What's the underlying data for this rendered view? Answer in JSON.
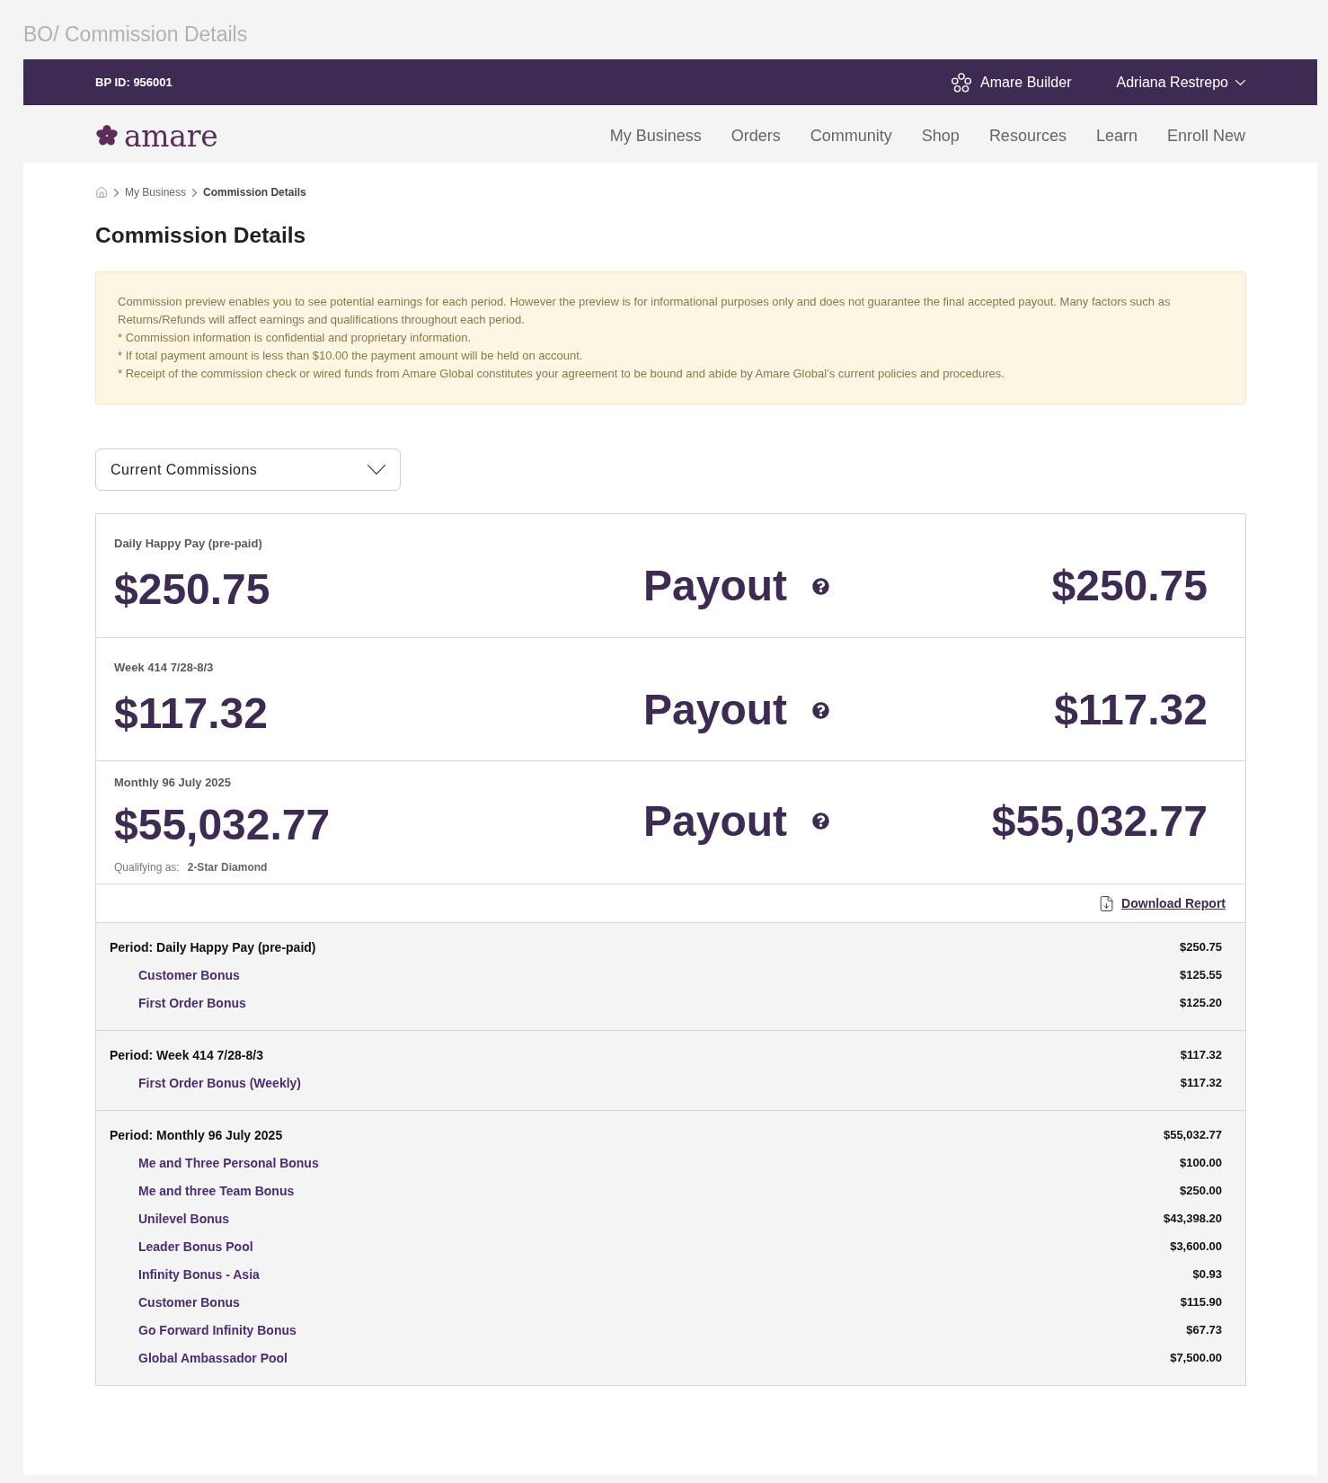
{
  "page_title": "BO/ Commission Details",
  "top_bar": {
    "bp_id": "BP ID: 956001",
    "builder_link": "Amare Builder",
    "user_menu": "Adriana Restrepo"
  },
  "nav": {
    "logo": "amare",
    "items": [
      "My Business",
      "Orders",
      "Community",
      "Shop",
      "Resources",
      "Learn",
      "Enroll New"
    ]
  },
  "breadcrumb": [
    {
      "label": "My Business",
      "current": false
    },
    {
      "label": "Commission Details",
      "current": true
    }
  ],
  "heading": "Commission Details",
  "notice": {
    "paragraph": "Commission preview enables you to see potential earnings for each period. However the preview is for informational purposes only and does not guarantee the final accepted payout. Many factors such as Returns/Refunds will affect earnings and qualifications throughout each period.",
    "bullets": [
      "* Commission information is confidential and proprietary information.",
      "* If total payment amount is less than $10.00 the payment amount will be held on account.",
      "* Receipt of the commission check or wired funds from Amare Global constitutes your agreement to be bound and abide by Amare Global’s current policies and procedures."
    ]
  },
  "period_select": {
    "value": "Current Commissions"
  },
  "summaries": [
    {
      "label": "Daily Happy Pay (pre-paid)",
      "amount": "$250.75",
      "payout_label": "Payout",
      "payout": "$250.75"
    },
    {
      "label": "Week 414 7/28-8/3",
      "amount": "$117.32",
      "payout_label": "Payout",
      "payout": "$117.32"
    },
    {
      "label": "Monthly 96 July 2025",
      "amount": "$55,032.77",
      "payout_label": "Payout",
      "payout": "$55,032.77",
      "qualifying": {
        "label": "Qualifying as:",
        "value": "2-Star Diamond"
      }
    }
  ],
  "download_link": "Download Report",
  "periods": [
    {
      "title": "Period: Daily Happy Pay (pre-paid)",
      "total": "$250.75",
      "items": [
        {
          "name": "Customer Bonus",
          "amount": "$125.55"
        },
        {
          "name": "First Order Bonus",
          "amount": "$125.20"
        }
      ]
    },
    {
      "title": "Period: Week 414 7/28-8/3",
      "total": "$117.32",
      "items": [
        {
          "name": "First Order Bonus (Weekly)",
          "amount": "$117.32"
        }
      ]
    },
    {
      "title": "Period: Monthly 96 July 2025",
      "total": "$55,032.77",
      "items": [
        {
          "name": "Me and Three Personal Bonus",
          "amount": "$100.00"
        },
        {
          "name": "Me and three Team Bonus",
          "amount": "$250.00"
        },
        {
          "name": "Unilevel Bonus",
          "amount": "$43,398.20"
        },
        {
          "name": "Leader Bonus Pool",
          "amount": "$3,600.00"
        },
        {
          "name": "Infinity Bonus - Asia",
          "amount": "$0.93"
        },
        {
          "name": "Customer Bonus",
          "amount": "$115.90"
        },
        {
          "name": "Go Forward Infinity Bonus",
          "amount": "$67.73"
        },
        {
          "name": "Global Ambassador Pool",
          "amount": "$7,500.00"
        }
      ]
    }
  ]
}
